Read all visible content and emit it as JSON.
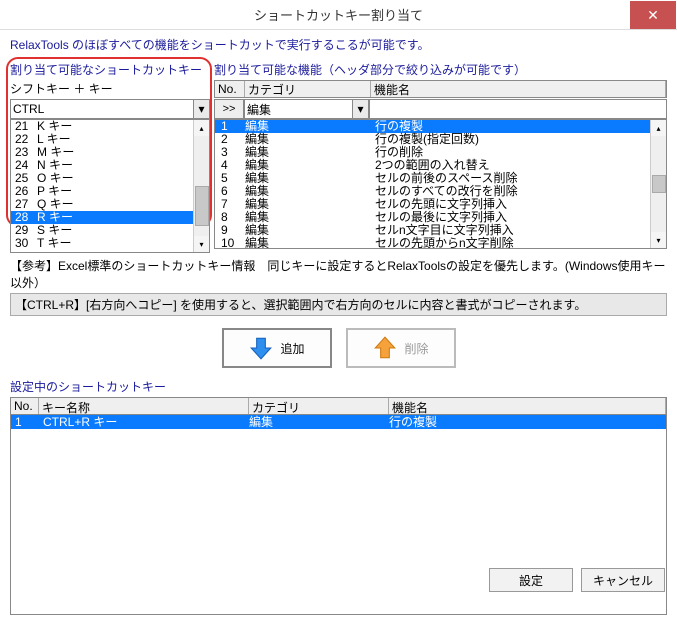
{
  "window": {
    "title": "ショートカットキー割り当て",
    "close_icon": "✕"
  },
  "intro": "RelaxTools のほぼすべての機能をショートカットで実行するこるが可能です。",
  "left_panel": {
    "title": "割り当て可能なショートカットキー",
    "modifier_label": "シフトキー ＋ キー",
    "modifier_value": "CTRL",
    "items": [
      {
        "no": "21",
        "key": "K キー",
        "sel": false
      },
      {
        "no": "22",
        "key": "L キー",
        "sel": false
      },
      {
        "no": "23",
        "key": "M キー",
        "sel": false
      },
      {
        "no": "24",
        "key": "N キー",
        "sel": false
      },
      {
        "no": "25",
        "key": "O キー",
        "sel": false
      },
      {
        "no": "26",
        "key": "P キー",
        "sel": false
      },
      {
        "no": "27",
        "key": "Q キー",
        "sel": false
      },
      {
        "no": "28",
        "key": "R キー",
        "sel": true
      },
      {
        "no": "29",
        "key": "S キー",
        "sel": false
      },
      {
        "no": "30",
        "key": "T キー",
        "sel": false
      }
    ]
  },
  "right_panel": {
    "title": "割り当て可能な機能（ヘッダ部分で絞り込みが可能です）",
    "hdr_no": "No.",
    "hdr_cat": "カテゴリ",
    "hdr_func": "機能名",
    "filter_btn": ">>",
    "filter_cat": "編集",
    "rows": [
      {
        "no": "1",
        "cat": "編集",
        "func": "行の複製",
        "sel": true
      },
      {
        "no": "2",
        "cat": "編集",
        "func": "行の複製(指定回数)",
        "sel": false
      },
      {
        "no": "3",
        "cat": "編集",
        "func": "行の削除",
        "sel": false
      },
      {
        "no": "4",
        "cat": "編集",
        "func": "2つの範囲の入れ替え",
        "sel": false
      },
      {
        "no": "5",
        "cat": "編集",
        "func": "セルの前後のスペース削除",
        "sel": false
      },
      {
        "no": "6",
        "cat": "編集",
        "func": "セルのすべての改行を削除",
        "sel": false
      },
      {
        "no": "7",
        "cat": "編集",
        "func": "セルの先頭に文字列挿入",
        "sel": false
      },
      {
        "no": "8",
        "cat": "編集",
        "func": "セルの最後に文字列挿入",
        "sel": false
      },
      {
        "no": "9",
        "cat": "編集",
        "func": "セルn文字目に文字列挿入",
        "sel": false
      },
      {
        "no": "10",
        "cat": "編集",
        "func": "セルの先頭からn文字削除",
        "sel": false
      }
    ]
  },
  "reference": {
    "line1": "【参考】Excel標準のショートカットキー情報　同じキーに設定するとRelaxToolsの設定を優先します。(Windows使用キー以外）",
    "line2": "【CTRL+R】[右方向へコピー] を使用すると、選択範囲内で右方向のセルに内容と書式がコピーされます。"
  },
  "buttons": {
    "add": "追加",
    "remove": "削除"
  },
  "assigned": {
    "title": "設定中のショートカットキー",
    "hdr_no": "No.",
    "hdr_key": "キー名称",
    "hdr_cat": "カテゴリ",
    "hdr_func": "機能名",
    "rows": [
      {
        "no": "1",
        "key": "CTRL+R キー",
        "cat": "編集",
        "func": "行の複製",
        "sel": true
      }
    ]
  },
  "footer": {
    "ok": "設定",
    "cancel": "キャンセル"
  }
}
